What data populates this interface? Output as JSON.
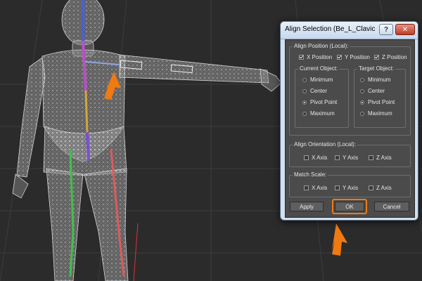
{
  "dialog": {
    "title": "Align Selection (Be_L_ClavicleEn...",
    "help_icon": "?",
    "close_icon": "✕",
    "align_position": {
      "group_title": "Align Position (Local):",
      "axes": [
        {
          "label": "X Position",
          "checked": true
        },
        {
          "label": "Y Position",
          "checked": true
        },
        {
          "label": "Z Position",
          "checked": true
        }
      ],
      "current_object": {
        "title": "Current Object:",
        "options": [
          "Minimum",
          "Center",
          "Pivot Point",
          "Maximum"
        ],
        "selected": "Pivot Point"
      },
      "target_object": {
        "title": "Target Object:",
        "options": [
          "Minimum",
          "Center",
          "Pivot Point",
          "Maximum"
        ],
        "selected": "Pivot Point"
      }
    },
    "align_orientation": {
      "group_title": "Align Orientation (Local):",
      "axes": [
        "X Axis",
        "Y Axis",
        "Z Axis"
      ]
    },
    "match_scale": {
      "group_title": "Match Scale:",
      "axes": [
        "X Axis",
        "Y Axis",
        "Z Axis"
      ]
    },
    "buttons": {
      "apply": "Apply",
      "ok": "OK",
      "cancel": "Cancel"
    }
  },
  "colors": {
    "viewport_bg": "#2b2b2b",
    "grid": "#3b3b3b",
    "wireframe": "#c6c6c6",
    "highlight_orange": "#f07a12",
    "dialog_frame": "#cfe0f2",
    "panel_bg": "#4b4b4b"
  }
}
